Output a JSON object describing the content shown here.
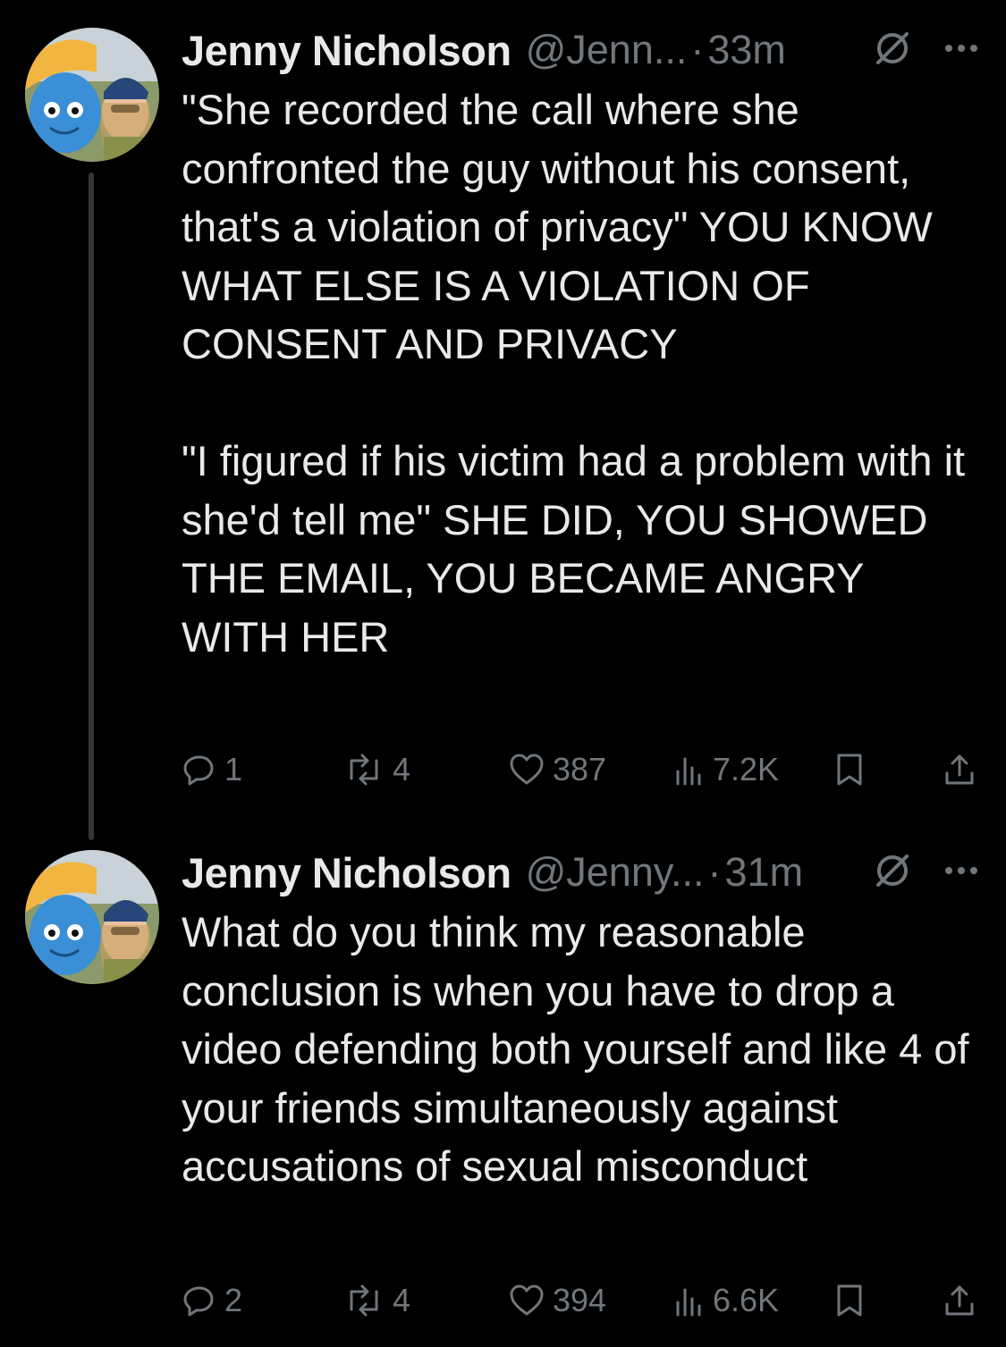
{
  "tweets": [
    {
      "author_name": "Jenny Nicholson",
      "handle": "@Jenn...",
      "separator": "·",
      "time": "33m",
      "text": "\"She recorded the call where she confronted the guy without his consent, that's a violation of privacy\" YOU KNOW WHAT ELSE IS A VIOLATION OF CONSENT AND PRIVACY\n\n\"I figured if his victim had a problem with it she'd tell me\" SHE DID, YOU SHOWED THE EMAIL, YOU BECAME ANGRY WITH HER",
      "replies": "1",
      "reposts": "4",
      "likes": "387",
      "views": "7.2K"
    },
    {
      "author_name": "Jenny Nicholson",
      "handle": "@Jenny...",
      "separator": "·",
      "time": "31m",
      "text": "What do you think my reasonable conclusion is when you have to drop a video defending both yourself and like 4 of your friends simultaneously against accusations of sexual misconduct",
      "replies": "2",
      "reposts": "4",
      "likes": "394",
      "views": "6.6K"
    }
  ],
  "icons": {
    "grok": "grok-icon",
    "more": "more-icon",
    "reply": "reply-icon",
    "repost": "repost-icon",
    "like": "heart-icon",
    "views": "views-icon",
    "bookmark": "bookmark-icon",
    "share": "share-icon"
  },
  "colors": {
    "background": "#000000",
    "text": "#e7e9ea",
    "secondary": "#71767b",
    "thread_line": "#333639"
  }
}
